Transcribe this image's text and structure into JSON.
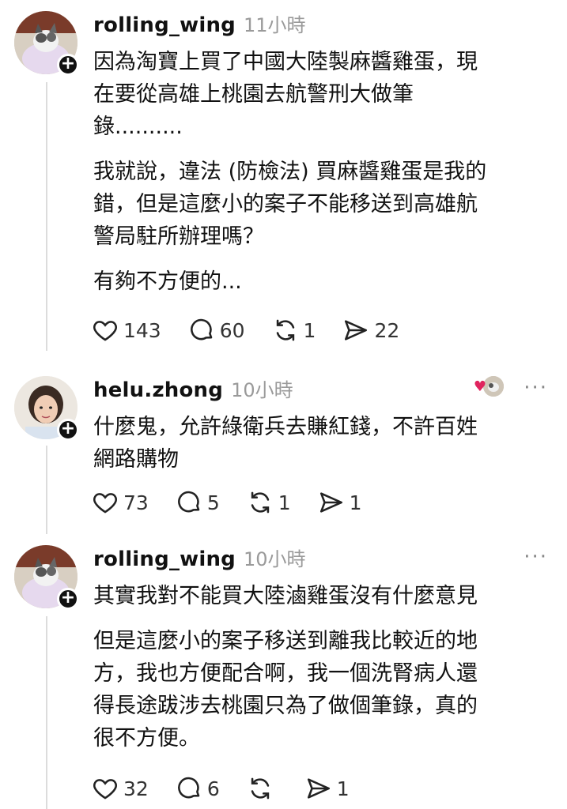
{
  "posts": [
    {
      "username": "rolling_wing",
      "time": "11小時",
      "paragraphs": [
        "因為淘寶上買了中國大陸製麻醬雞蛋，現\n在要從高雄上桃園去航警刑大做筆\n錄..........",
        "我就說，違法 (防檢法) 買麻醬雞蛋是我的\n錯，但是這麼小的案子不能移送到高雄航\n警局駐所辦理嗎？",
        "有夠不方便的..."
      ],
      "likes": "143",
      "comments": "60",
      "reposts": "1",
      "shares": "22"
    },
    {
      "username": "helu.zhong",
      "time": "10小時",
      "paragraphs": [
        "什麼鬼，允許綠衛兵去賺紅錢，不許百姓\n網路購物"
      ],
      "likes": "73",
      "comments": "5",
      "reposts": "1",
      "shares": "1"
    },
    {
      "username": "rolling_wing",
      "time": "10小時",
      "paragraphs": [
        "其實我對不能買大陸滷雞蛋沒有什麼意見",
        "但是這麼小的案子移送到離我比較近的地\n方，我也方便配合啊，我一個洗腎病人還\n得長途跋涉去桃園只為了做個筆錄，真的\n很不方便。"
      ],
      "likes": "32",
      "comments": "6",
      "reposts": "",
      "shares": "1"
    }
  ],
  "icons": {
    "like": "heart-icon",
    "comment": "comment-bubble-icon",
    "repost": "repost-icon",
    "share": "share-icon",
    "more": "more-options-icon",
    "follow": "plus-icon"
  },
  "colors": {
    "text": "#111111",
    "muted": "#9a9a9a",
    "thread_line": "#dcdcdc",
    "heart_red": "#e0245e"
  }
}
